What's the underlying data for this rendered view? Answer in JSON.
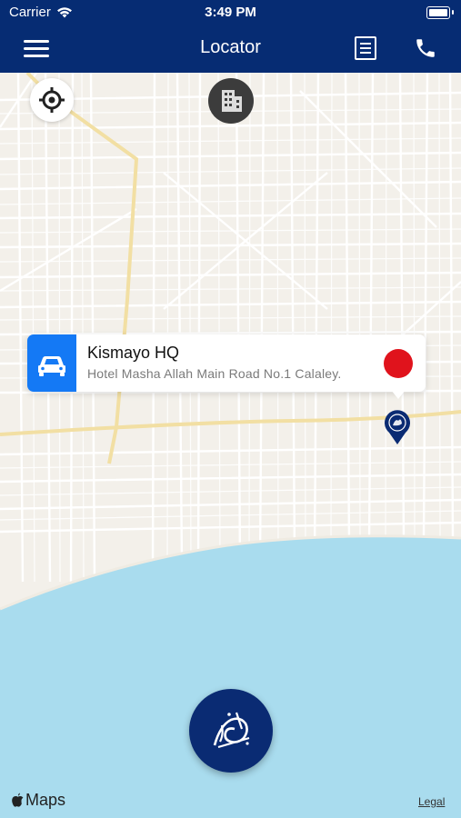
{
  "status_bar": {
    "carrier": "Carrier",
    "time": "3:49 PM"
  },
  "navbar": {
    "title": "Locator",
    "menu_icon": "hamburger-menu-icon",
    "list_icon": "list-icon",
    "phone_icon": "phone-icon"
  },
  "map_controls": {
    "locate_icon": "crosshair-icon",
    "building_icon": "building-icon"
  },
  "callout": {
    "name": "Kismayo HQ",
    "address": "Hotel Masha Allah Main Road No.1 Calaley.",
    "icon": "car-icon"
  },
  "footer": {
    "maps_label": "Maps",
    "legal": "Legal"
  },
  "colors": {
    "navbar": "#062c73",
    "accent": "#1479f5",
    "marker": "#e0131c",
    "sea": "#a9dcee",
    "land": "#f3f0ea"
  }
}
